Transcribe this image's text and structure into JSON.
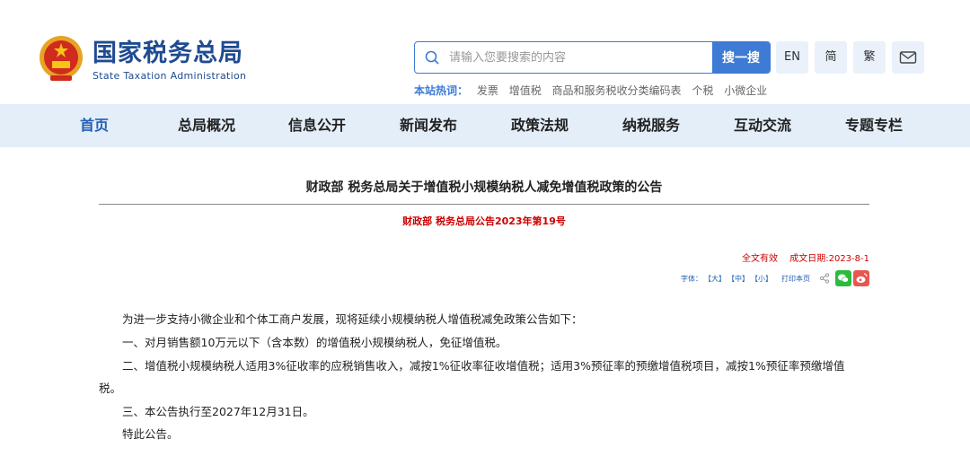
{
  "header": {
    "logo_cn": "国家税务总局",
    "logo_en": "State Taxation Administration",
    "search": {
      "placeholder": "请输入您要搜索的内容",
      "button": "搜一搜"
    },
    "lang": [
      "EN",
      "简",
      "繁"
    ],
    "hot_label": "本站热词：",
    "hot_words": [
      "发票",
      "增值税",
      "商品和服务税收分类编码表",
      "个税",
      "小微企业"
    ]
  },
  "nav": {
    "items": [
      "首页",
      "总局概况",
      "信息公开",
      "新闻发布",
      "政策法规",
      "纳税服务",
      "互动交流",
      "专题专栏"
    ],
    "active": "首页"
  },
  "article": {
    "title": "财政部 税务总局关于增值税小规模纳税人减免增值税政策的公告",
    "subtitle": "财政部 税务总局公告2023年第19号",
    "validity": "全文有效",
    "date": "成文日期:2023-8-1",
    "tools": {
      "font_label": "字体：",
      "large": "【大】",
      "medium": "【中】",
      "small": "【小】",
      "print": "打印本页"
    },
    "paragraphs": [
      "为进一步支持小微企业和个体工商户发展，现将延续小规模纳税人增值税减免政策公告如下：",
      "一、对月销售额10万元以下（含本数）的增值税小规模纳税人，免征增值税。",
      "二、增值税小规模纳税人适用3%征收率的应税销售收入，减按1%征收率征收增值税；适用3%预征率的预缴增值税项目，减按1%预征率预缴增值",
      "税。",
      "三、本公告执行至2027年12月31日。",
      "特此公告。"
    ]
  },
  "colors": {
    "brand": "#1f4b91",
    "accent": "#3d7bd4",
    "nav_bg": "#e3eef9",
    "alert": "#cc0000"
  }
}
